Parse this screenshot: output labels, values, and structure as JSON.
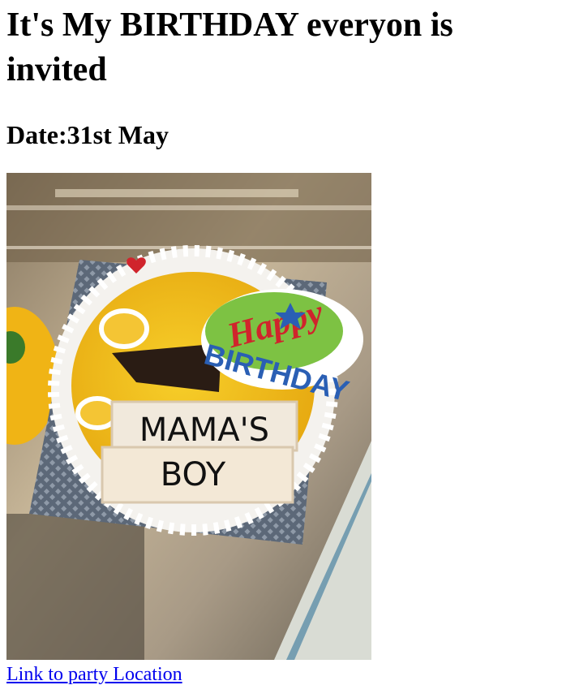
{
  "heading": "It's My BIRTHDAY everyon is invited",
  "date_line": "Date:31st May",
  "image": {
    "description_icon": "birthday-cake-photo",
    "topper_text_1": "Happy",
    "topper_text_2": "BIRTHDAY",
    "wafer_text_1": "MAMA'S",
    "wafer_text_2": "BOY"
  },
  "link": {
    "label": "Link to party Location"
  },
  "colors": {
    "link": "#0000ee",
    "text": "#000000",
    "background": "#ffffff"
  }
}
